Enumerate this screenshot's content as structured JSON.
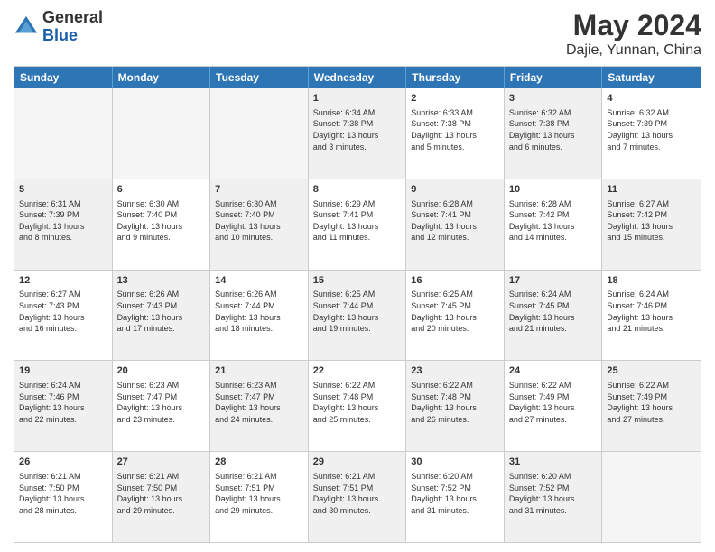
{
  "header": {
    "logo_line1": "General",
    "logo_line2": "Blue",
    "month_year": "May 2024",
    "location": "Dajie, Yunnan, China"
  },
  "days_of_week": [
    "Sunday",
    "Monday",
    "Tuesday",
    "Wednesday",
    "Thursday",
    "Friday",
    "Saturday"
  ],
  "weeks": [
    [
      {
        "day": "",
        "text": "",
        "empty": true
      },
      {
        "day": "",
        "text": "",
        "empty": true
      },
      {
        "day": "",
        "text": "",
        "empty": true
      },
      {
        "day": "1",
        "text": "Sunrise: 6:34 AM\nSunset: 7:38 PM\nDaylight: 13 hours\nand 3 minutes.",
        "shaded": true
      },
      {
        "day": "2",
        "text": "Sunrise: 6:33 AM\nSunset: 7:38 PM\nDaylight: 13 hours\nand 5 minutes.",
        "shaded": false
      },
      {
        "day": "3",
        "text": "Sunrise: 6:32 AM\nSunset: 7:38 PM\nDaylight: 13 hours\nand 6 minutes.",
        "shaded": true
      },
      {
        "day": "4",
        "text": "Sunrise: 6:32 AM\nSunset: 7:39 PM\nDaylight: 13 hours\nand 7 minutes.",
        "shaded": false
      }
    ],
    [
      {
        "day": "5",
        "text": "Sunrise: 6:31 AM\nSunset: 7:39 PM\nDaylight: 13 hours\nand 8 minutes.",
        "shaded": true
      },
      {
        "day": "6",
        "text": "Sunrise: 6:30 AM\nSunset: 7:40 PM\nDaylight: 13 hours\nand 9 minutes.",
        "shaded": false
      },
      {
        "day": "7",
        "text": "Sunrise: 6:30 AM\nSunset: 7:40 PM\nDaylight: 13 hours\nand 10 minutes.",
        "shaded": true
      },
      {
        "day": "8",
        "text": "Sunrise: 6:29 AM\nSunset: 7:41 PM\nDaylight: 13 hours\nand 11 minutes.",
        "shaded": false
      },
      {
        "day": "9",
        "text": "Sunrise: 6:28 AM\nSunset: 7:41 PM\nDaylight: 13 hours\nand 12 minutes.",
        "shaded": true
      },
      {
        "day": "10",
        "text": "Sunrise: 6:28 AM\nSunset: 7:42 PM\nDaylight: 13 hours\nand 14 minutes.",
        "shaded": false
      },
      {
        "day": "11",
        "text": "Sunrise: 6:27 AM\nSunset: 7:42 PM\nDaylight: 13 hours\nand 15 minutes.",
        "shaded": true
      }
    ],
    [
      {
        "day": "12",
        "text": "Sunrise: 6:27 AM\nSunset: 7:43 PM\nDaylight: 13 hours\nand 16 minutes.",
        "shaded": false
      },
      {
        "day": "13",
        "text": "Sunrise: 6:26 AM\nSunset: 7:43 PM\nDaylight: 13 hours\nand 17 minutes.",
        "shaded": true
      },
      {
        "day": "14",
        "text": "Sunrise: 6:26 AM\nSunset: 7:44 PM\nDaylight: 13 hours\nand 18 minutes.",
        "shaded": false
      },
      {
        "day": "15",
        "text": "Sunrise: 6:25 AM\nSunset: 7:44 PM\nDaylight: 13 hours\nand 19 minutes.",
        "shaded": true
      },
      {
        "day": "16",
        "text": "Sunrise: 6:25 AM\nSunset: 7:45 PM\nDaylight: 13 hours\nand 20 minutes.",
        "shaded": false
      },
      {
        "day": "17",
        "text": "Sunrise: 6:24 AM\nSunset: 7:45 PM\nDaylight: 13 hours\nand 21 minutes.",
        "shaded": true
      },
      {
        "day": "18",
        "text": "Sunrise: 6:24 AM\nSunset: 7:46 PM\nDaylight: 13 hours\nand 21 minutes.",
        "shaded": false
      }
    ],
    [
      {
        "day": "19",
        "text": "Sunrise: 6:24 AM\nSunset: 7:46 PM\nDaylight: 13 hours\nand 22 minutes.",
        "shaded": true
      },
      {
        "day": "20",
        "text": "Sunrise: 6:23 AM\nSunset: 7:47 PM\nDaylight: 13 hours\nand 23 minutes.",
        "shaded": false
      },
      {
        "day": "21",
        "text": "Sunrise: 6:23 AM\nSunset: 7:47 PM\nDaylight: 13 hours\nand 24 minutes.",
        "shaded": true
      },
      {
        "day": "22",
        "text": "Sunrise: 6:22 AM\nSunset: 7:48 PM\nDaylight: 13 hours\nand 25 minutes.",
        "shaded": false
      },
      {
        "day": "23",
        "text": "Sunrise: 6:22 AM\nSunset: 7:48 PM\nDaylight: 13 hours\nand 26 minutes.",
        "shaded": true
      },
      {
        "day": "24",
        "text": "Sunrise: 6:22 AM\nSunset: 7:49 PM\nDaylight: 13 hours\nand 27 minutes.",
        "shaded": false
      },
      {
        "day": "25",
        "text": "Sunrise: 6:22 AM\nSunset: 7:49 PM\nDaylight: 13 hours\nand 27 minutes.",
        "shaded": true
      }
    ],
    [
      {
        "day": "26",
        "text": "Sunrise: 6:21 AM\nSunset: 7:50 PM\nDaylight: 13 hours\nand 28 minutes.",
        "shaded": false
      },
      {
        "day": "27",
        "text": "Sunrise: 6:21 AM\nSunset: 7:50 PM\nDaylight: 13 hours\nand 29 minutes.",
        "shaded": true
      },
      {
        "day": "28",
        "text": "Sunrise: 6:21 AM\nSunset: 7:51 PM\nDaylight: 13 hours\nand 29 minutes.",
        "shaded": false
      },
      {
        "day": "29",
        "text": "Sunrise: 6:21 AM\nSunset: 7:51 PM\nDaylight: 13 hours\nand 30 minutes.",
        "shaded": true
      },
      {
        "day": "30",
        "text": "Sunrise: 6:20 AM\nSunset: 7:52 PM\nDaylight: 13 hours\nand 31 minutes.",
        "shaded": false
      },
      {
        "day": "31",
        "text": "Sunrise: 6:20 AM\nSunset: 7:52 PM\nDaylight: 13 hours\nand 31 minutes.",
        "shaded": true
      },
      {
        "day": "",
        "text": "",
        "empty": true
      }
    ]
  ]
}
